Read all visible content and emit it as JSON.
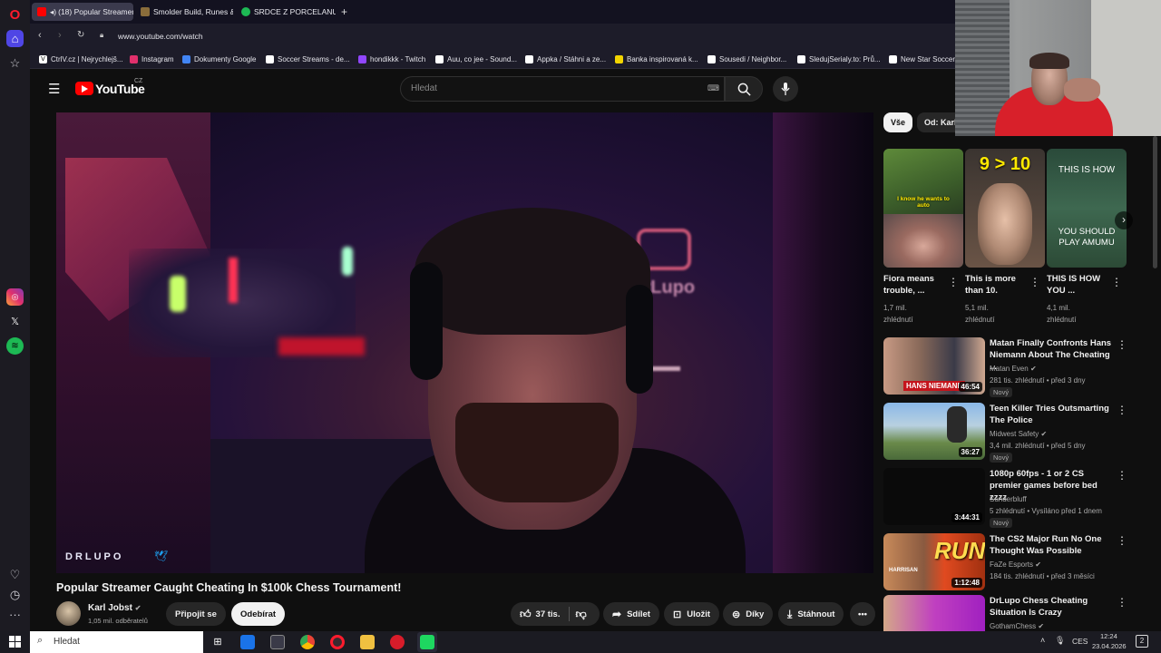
{
  "browser": {
    "tabs": [
      {
        "label": "(18) Popular Streamer",
        "active": true
      },
      {
        "label": "Smolder Build, Runes & C"
      },
      {
        "label": "SRDCE Z PORCELANU - Al"
      }
    ],
    "url": "www.youtube.com/watch",
    "bookmarks": [
      "CtrlV.cz | Nejrychlejš...",
      "Instagram",
      "Dokumenty Google",
      "Soccer Streams - de...",
      "hondikkk - Twitch",
      "Auu, co jee - Sound...",
      "Appka / Stáhni a ze...",
      "Banka inspirovaná k...",
      "Sousedi / Neighbor...",
      "SledujSerialy.to: Prů...",
      "New Star Soccer"
    ]
  },
  "youtube": {
    "logo_text": "YouTube",
    "region": "CZ",
    "search_placeholder": "Hledat"
  },
  "video": {
    "watermark": "DRLUPO",
    "title": "Popular Streamer Caught Cheating In $100k Chess Tournament!",
    "channel": "Karl Jobst",
    "subscribers": "1,05 mil. odběratelů",
    "join_label": "Připojit se",
    "subscribe_label": "Odebírat",
    "likes": "37 tis.",
    "share_label": "Sdílet",
    "save_label": "Uložit",
    "thanks_label": "Díky",
    "download_label": "Stáhnout"
  },
  "chips": [
    "Vše",
    "Od: Karl"
  ],
  "shelf": [
    {
      "title": "Fiora means trouble, ...",
      "views": "1,7 mil.",
      "views2": "zhlédnutí",
      "thumb_text": "I know he wants to auto"
    },
    {
      "title": "This is more than 10.",
      "views": "5,1 mil.",
      "views2": "zhlédnutí",
      "thumb_text": "9 > 10"
    },
    {
      "title": "THIS IS HOW YOU ...",
      "views": "4,1 mil.",
      "views2": "zhlédnutí",
      "thumb_text": "THIS IS HOW",
      "thumb_text2": "YOU SHOULD PLAY AMUMU"
    }
  ],
  "recommendations": [
    {
      "title": "Matan Finally Confronts Hans Niemann About The Cheating ...",
      "channel": "Matan Even",
      "meta": "281 tis. zhlédnutí • před 3 dny",
      "badge": "Nový",
      "duration": "46:54",
      "thumb_text": "HANS NIEMANN"
    },
    {
      "title": "Teen Killer Tries Outsmarting The Police",
      "channel": "Midwest Safety",
      "meta": "3,4 mil. zhlédnutí • před 5 dny",
      "badge": "Nový",
      "duration": "36:27"
    },
    {
      "title": "1080p 60fps - 1 or 2 CS premier games before bed zzzz",
      "channel": "Sunderbluff",
      "meta": "5 zhlédnutí • Vysíláno před 1 dnem",
      "badge": "Nový",
      "duration": "3:44:31"
    },
    {
      "title": "The CS2 Major Run No One Thought Was Possible",
      "channel": "FaZe Esports",
      "meta": "184 tis. zhlédnutí • před 3 měsíci",
      "duration": "1:12:48",
      "thumb_text": "RUN",
      "thumb_text2": "HARRISAN"
    },
    {
      "title": "DrLupo Chess Cheating Situation Is Crazy",
      "channel": "GothamChess"
    }
  ],
  "taskbar": {
    "search_placeholder": "Hledat",
    "lang": "CES",
    "time": "12:24",
    "date": "23.04.2026",
    "notifications": "2"
  }
}
